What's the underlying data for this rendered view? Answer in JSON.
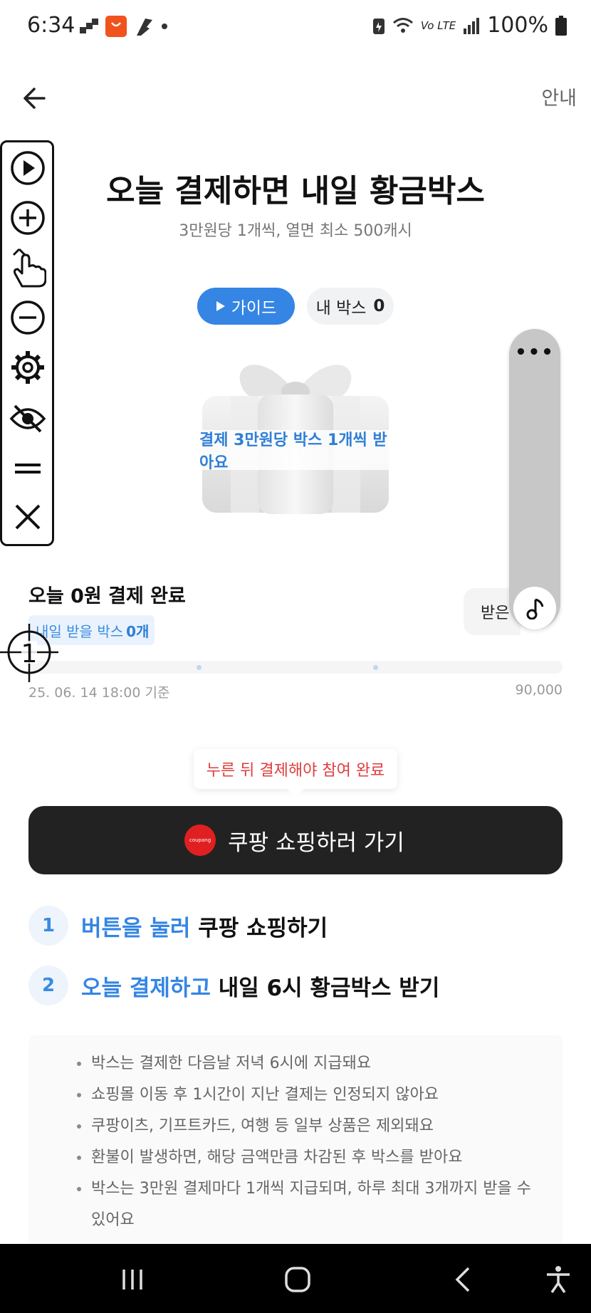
{
  "status": {
    "time": "6:34",
    "battery": "100%",
    "network": "Vo LTE"
  },
  "header": {
    "guide_link": "안내"
  },
  "hero": {
    "title": "오늘 결제하면 내일 황금박스",
    "subtitle": "3만원당 1개씩, 열면 최소 500캐시",
    "guide_button": "가이드",
    "mybox_label": "내 박스",
    "mybox_count": "0",
    "gift_banner": "결제 3만원당 박스 1개씩 받아요"
  },
  "side_panel": {
    "dots": "•••",
    "received_label": "받은"
  },
  "progress": {
    "title": "오늘 0원 결제 완료",
    "badge_prefix": "내일 받을 박스",
    "badge_count": "0개",
    "as_of": "25. 06. 14 18:00 기준",
    "goal": "90,000",
    "current_amount": 0,
    "checkpoints": [
      30000,
      60000
    ]
  },
  "cursor_mark": {
    "label": "1"
  },
  "cta": {
    "tooltip": "누른 뒤 결제해야 참여 완료",
    "button_label": "쿠팡 쇼핑하러 가기",
    "logo_text": "coupang"
  },
  "steps": [
    {
      "num": "1",
      "highlight": "버튼을 눌러",
      "rest": "쿠팡 쇼핑하기"
    },
    {
      "num": "2",
      "highlight": "오늘 결제하고",
      "rest": "내일 6시 황금박스 받기"
    }
  ],
  "notices": [
    "박스는 결제한 다음날 저녁 6시에 지급돼요",
    "쇼핑몰 이동 후 1시간이 지난 결제는 인정되지 않아요",
    "쿠팡이츠, 기프트카드, 여행 등 일부 상품은 제외돼요",
    "환불이 발생하면, 해당 금액만큼 차감된 후 박스를 받아요",
    "박스는 3만원 결제마다 1개씩 지급되며, 하루 최대 3개까지 받을 수 있어요"
  ],
  "colors": {
    "accent_blue": "#3485e4",
    "cta_dark": "#222222",
    "tooltip_red": "#e03c3c",
    "coupang_red": "#e02020"
  },
  "icons": {
    "toolbar": [
      "play-circle-icon",
      "plus-circle-icon",
      "hand-pointer-icon",
      "minus-circle-icon",
      "gear-icon",
      "eye-off-icon",
      "equals-icon",
      "close-icon"
    ],
    "nav": [
      "recent-apps-icon",
      "home-icon",
      "back-icon",
      "accessibility-icon"
    ]
  }
}
